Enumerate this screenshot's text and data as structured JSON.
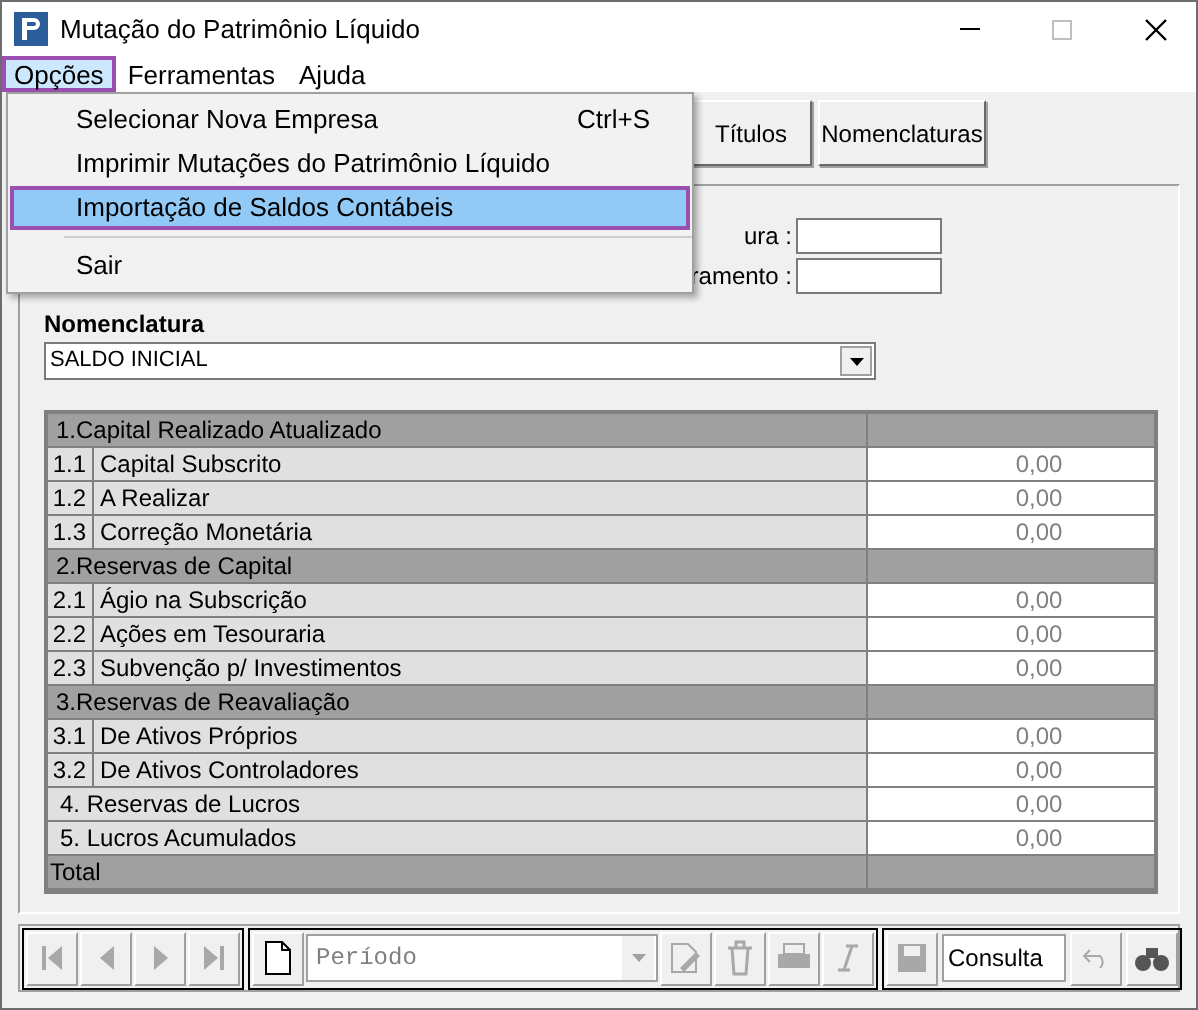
{
  "window": {
    "title": "Mutação do Patrimônio Líquido"
  },
  "menu_bar": [
    {
      "label": "Opções",
      "selected": true
    },
    {
      "label": "Ferramentas",
      "selected": false
    },
    {
      "label": "Ajuda",
      "selected": false
    }
  ],
  "dropdown_menu": [
    {
      "label": "Selecionar Nova Empresa",
      "shortcut": "Ctrl+S",
      "selected": false,
      "separator_after": false
    },
    {
      "label": "Imprimir Mutações do Patrimônio Líquido",
      "selected": false,
      "separator_after": false
    },
    {
      "label": "Importação de Saldos Contábeis",
      "selected": true,
      "separator_after": true
    },
    {
      "label": "Sair",
      "selected": false,
      "separator_after": false
    }
  ],
  "top_buttons": [
    {
      "label": "Títulos"
    },
    {
      "label": "Nomenclaturas"
    }
  ],
  "fields": [
    {
      "label": "ura :"
    },
    {
      "label": "ramento :"
    }
  ],
  "nomenclatura": {
    "label": "Nomenclatura",
    "value": "SALDO INICIAL"
  },
  "table": {
    "rows": [
      {
        "kind": "group",
        "label": "1.Capital Realizado Atualizado"
      },
      {
        "kind": "item",
        "number": "1.1",
        "label": "Capital Subscrito",
        "value": "0,00"
      },
      {
        "kind": "item",
        "number": "1.2",
        "label": "A Realizar",
        "value": "0,00"
      },
      {
        "kind": "item",
        "number": "1.3",
        "label": "Correção Monetária",
        "value": "0,00"
      },
      {
        "kind": "group",
        "label": "2.Reservas de Capital"
      },
      {
        "kind": "item",
        "number": "2.1",
        "label": "Ágio na Subscrição",
        "value": "0,00"
      },
      {
        "kind": "item",
        "number": "2.2",
        "label": "Ações em Tesouraria",
        "value": "0,00"
      },
      {
        "kind": "item",
        "number": "2.3",
        "label": "Subvenção p/ Investimentos",
        "value": "0,00"
      },
      {
        "kind": "group",
        "label": "3.Reservas de Reavaliação"
      },
      {
        "kind": "item",
        "number": "3.1",
        "label": "De Ativos Próprios",
        "value": "0,00"
      },
      {
        "kind": "item",
        "number": "3.2",
        "label": "De Ativos Controladores",
        "value": "0,00"
      },
      {
        "kind": "single",
        "label": "4. Reservas de Lucros",
        "value": "0,00"
      },
      {
        "kind": "single",
        "label": "5. Lucros Acumulados",
        "value": "0,00"
      },
      {
        "kind": "total",
        "label": "Total"
      }
    ]
  },
  "toolbar": {
    "period": {
      "placeholder": "Período"
    },
    "mode": "Consulta"
  }
}
